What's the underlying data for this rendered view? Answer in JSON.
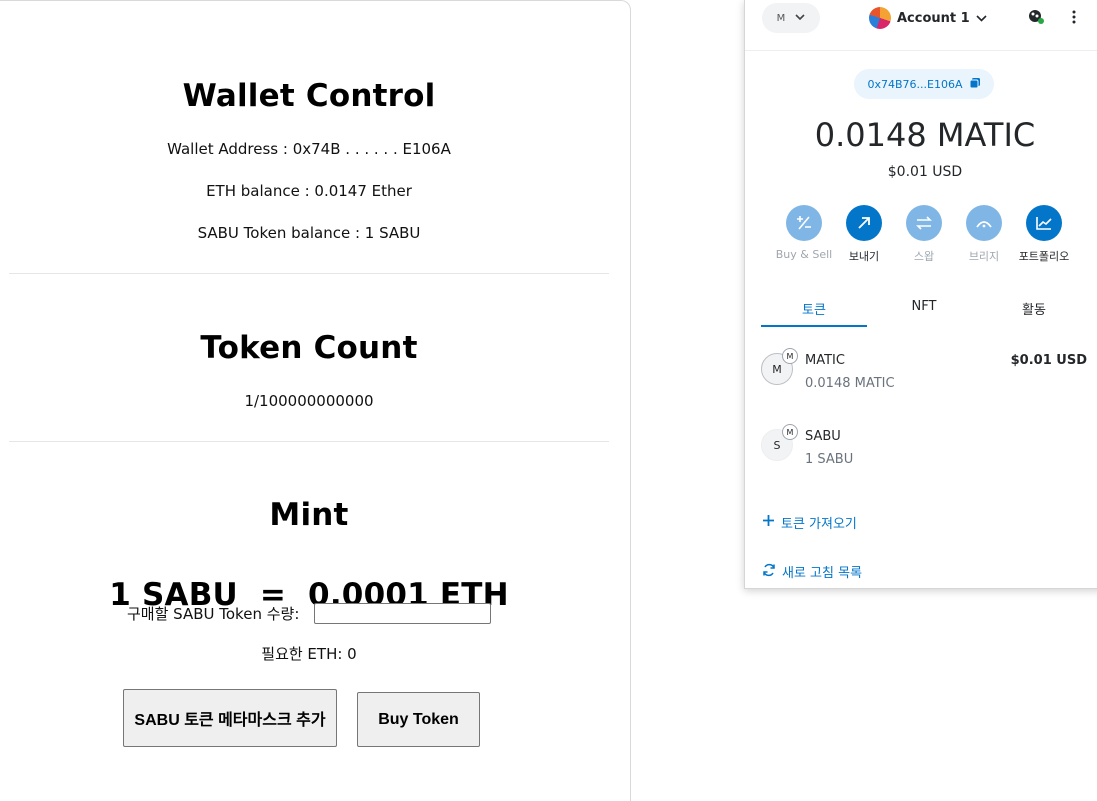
{
  "dapp": {
    "wallet": {
      "title": "Wallet Control",
      "address_line": "Wallet Address : 0x74B . . . . . . E106A",
      "eth_line": "ETH balance : 0.0147 Ether",
      "sabu_line": "SABU Token balance : 1 SABU"
    },
    "token_count": {
      "title": "Token Count",
      "value": "1/100000000000"
    },
    "mint": {
      "title": "Mint",
      "rate": "1 SABU  =  0.0001 ETH",
      "qty_label": "구매할 SABU Token 수량:",
      "qty_value": "",
      "required_eth": "필요한 ETH: 0",
      "add_button": "SABU 토큰 메타마스크 추가",
      "buy_button": "Buy Token"
    }
  },
  "metamask": {
    "network_initial": "M",
    "account_name": "Account 1",
    "address_short": "0x74B76...E106A",
    "balance": "0.0148 MATIC",
    "balance_usd": "$0.01 USD",
    "actions": [
      {
        "label": "Buy & Sell",
        "icon": "plus-minus-icon",
        "active": false
      },
      {
        "label": "보내기",
        "icon": "arrow-up-right-icon",
        "active": true
      },
      {
        "label": "스왑",
        "icon": "swap-icon",
        "active": false
      },
      {
        "label": "브리지",
        "icon": "bridge-icon",
        "active": false
      },
      {
        "label": "포트폴리오",
        "icon": "chart-icon",
        "active": true
      }
    ],
    "tabs": [
      "토큰",
      "NFT",
      "활동"
    ],
    "assets": [
      {
        "symbol_initial": "M",
        "badge": "M",
        "name": "MATIC",
        "amount": "0.0148 MATIC",
        "value": "$0.01 USD"
      },
      {
        "symbol_initial": "S",
        "badge": "M",
        "name": "SABU",
        "amount": "1 SABU",
        "value": ""
      }
    ],
    "import_tokens": "토큰 가져오기",
    "refresh_list": "새로 고침 목록",
    "colors": {
      "primary": "#0376c9",
      "inactive_action": "#7fb6e6"
    }
  }
}
